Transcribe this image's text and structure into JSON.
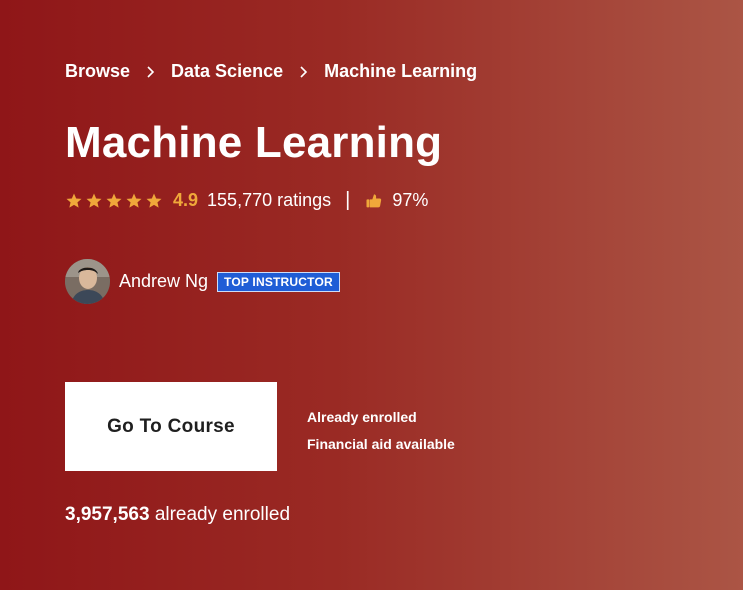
{
  "breadcrumb": [
    {
      "label": "Browse"
    },
    {
      "label": "Data Science"
    },
    {
      "label": "Machine Learning"
    }
  ],
  "course": {
    "title": "Machine Learning",
    "rating": {
      "stars": 5,
      "value": "4.9",
      "count_text": "155,770 ratings",
      "divider": "|",
      "like_percent": "97%"
    }
  },
  "instructor": {
    "name": "Andrew Ng",
    "badge": "TOP INSTRUCTOR"
  },
  "cta": {
    "button_label": "Go To Course",
    "notes": [
      "Already enrolled",
      "Financial aid available"
    ]
  },
  "enrollment": {
    "count": "3,957,563",
    "suffix": "already enrolled"
  },
  "colors": {
    "background_start": "#8f1618",
    "background_end": "#ab5545",
    "star": "#f0a83a",
    "badge": "#1f5dd6"
  }
}
